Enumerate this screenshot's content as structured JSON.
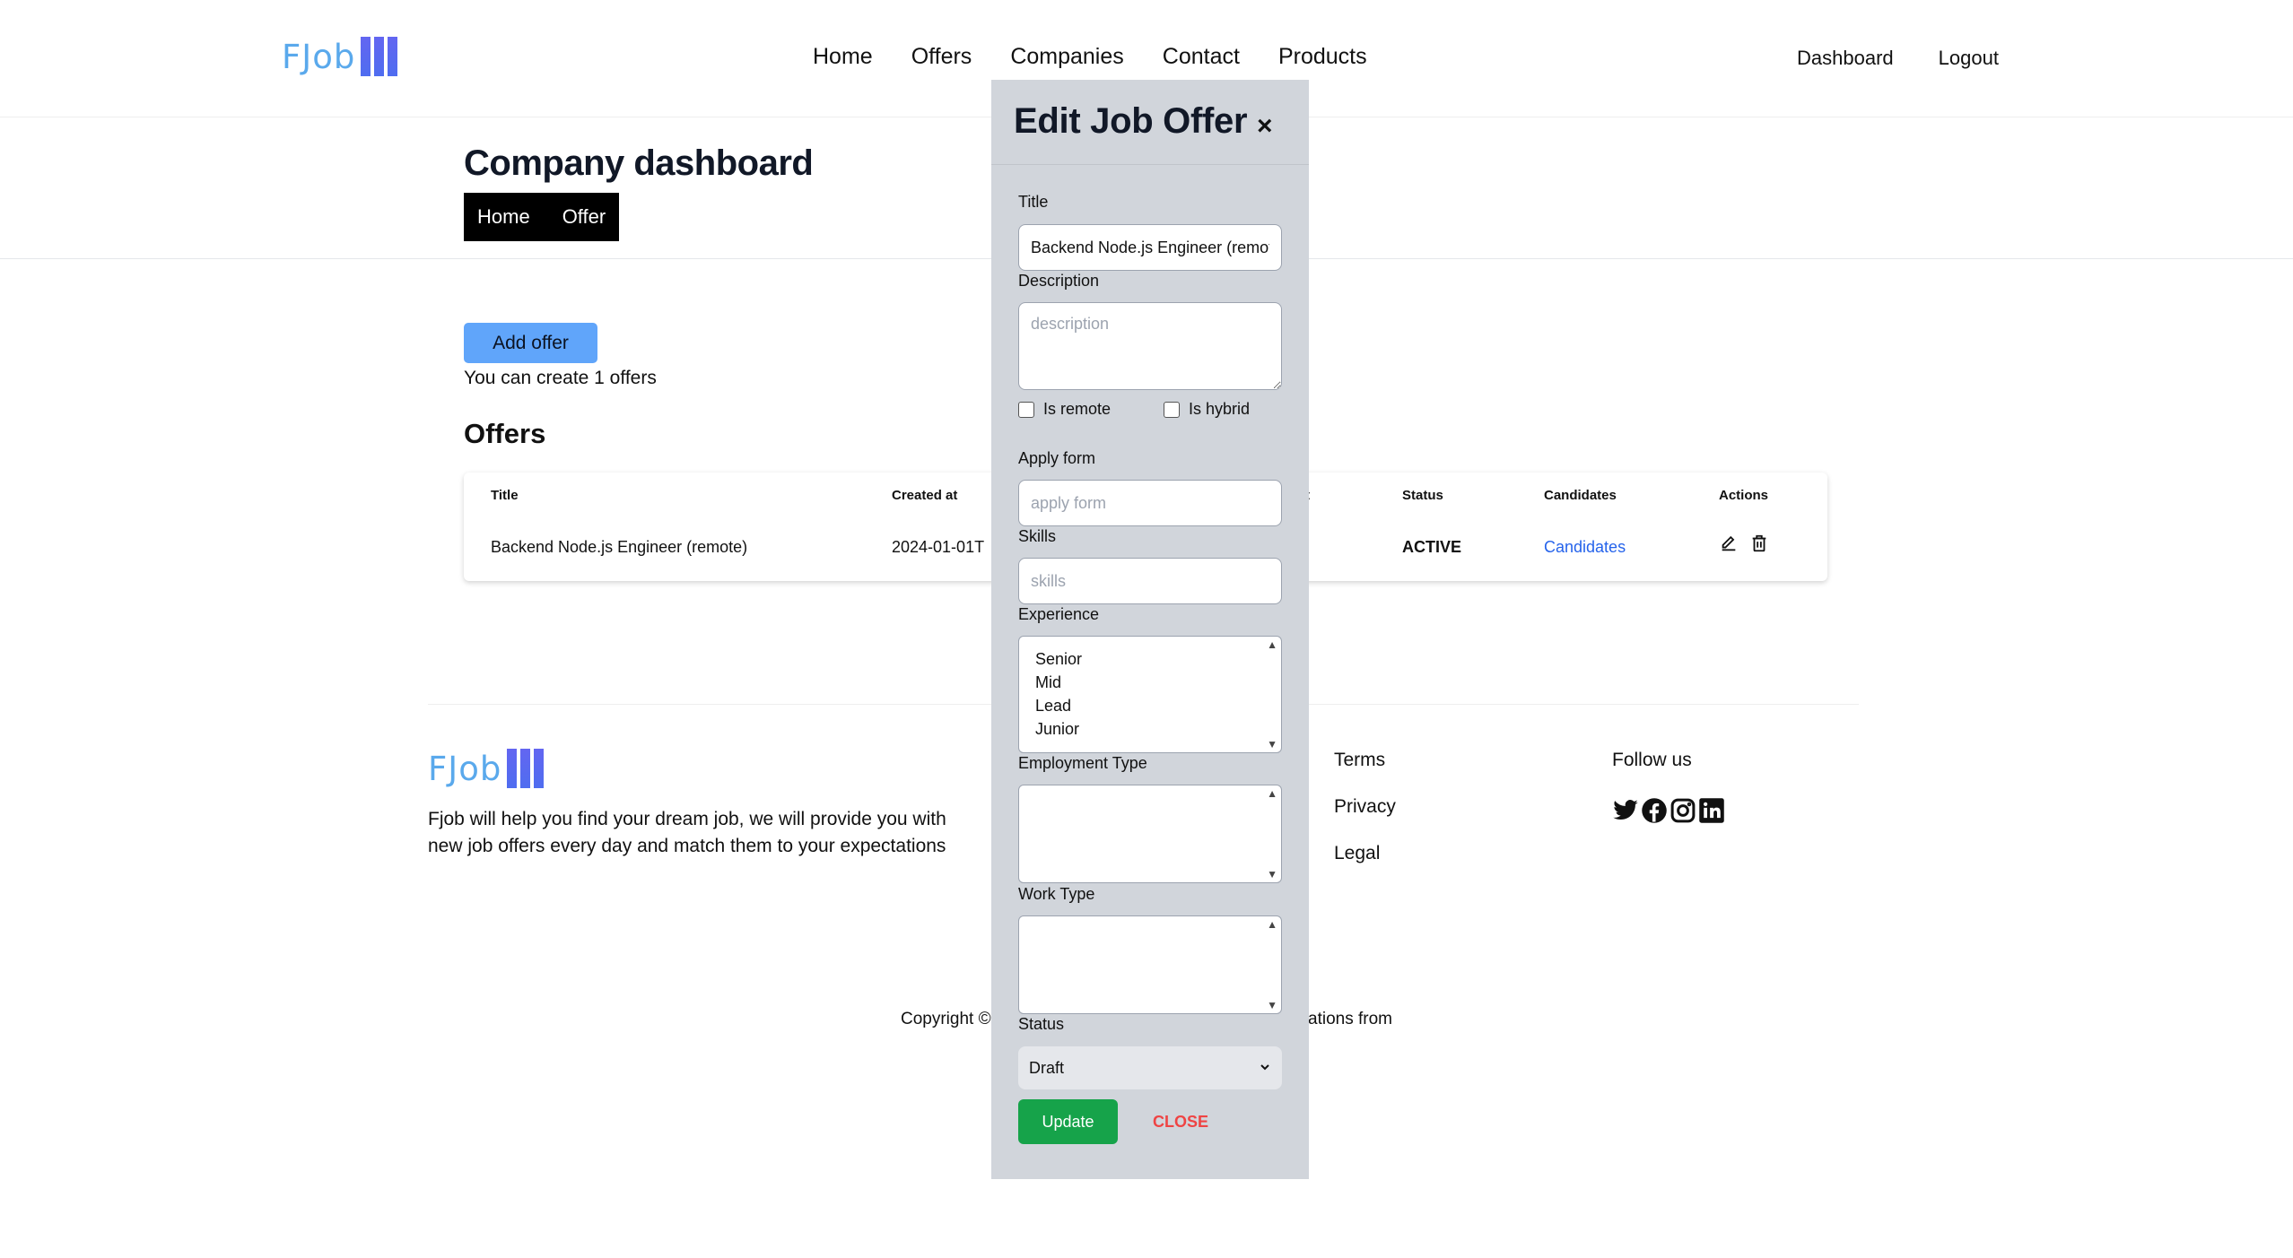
{
  "header": {
    "logo_text": "FJob",
    "nav": [
      "Home",
      "Offers",
      "Companies",
      "Contact",
      "Products"
    ],
    "nav_right": [
      "Dashboard",
      "Logout"
    ]
  },
  "dashboard": {
    "title": "Company dashboard",
    "subnav": [
      "Home",
      "Offer"
    ],
    "add_offer_label": "Add offer",
    "create_note": "You can create 1 offers",
    "offers_title": "Offers"
  },
  "table": {
    "headers": {
      "title": "Title",
      "created_at": "Created at",
      "expired_at_fragment": "t",
      "status": "Status",
      "candidates": "Candidates",
      "actions": "Actions"
    },
    "rows": [
      {
        "title": "Backend Node.js Engineer (remote)",
        "created_at": "2024-01-01T",
        "status": "ACTIVE",
        "candidates": "Candidates"
      }
    ]
  },
  "footer": {
    "logo_text": "FJob",
    "description": "Fjob will help you find your dream job, we will provide you with new job offers every day and match them to your expectations",
    "links": [
      "Terms",
      "Privacy",
      "Legal"
    ],
    "follow_label": "Follow us",
    "social_icons": [
      "twitter-icon",
      "facebook-icon",
      "instagram-icon",
      "linkedin-icon"
    ],
    "copyright_start": "Copyright ©",
    "copyright_end": "ations from"
  },
  "modal": {
    "title": "Edit Job Offer",
    "close_symbol": "×",
    "title_label": "Title",
    "title_value": "Backend Node.js Engineer (remote)",
    "description_label": "Description",
    "description_placeholder": "description",
    "is_remote_label": "Is remote",
    "is_hybrid_label": "Is hybrid",
    "apply_form_label": "Apply form",
    "apply_form_placeholder": "apply form",
    "skills_label": "Skills",
    "skills_placeholder": "skills",
    "experience_label": "Experience",
    "experience_options": [
      "Senior",
      "Mid",
      "Lead",
      "Junior"
    ],
    "employment_type_label": "Employment Type",
    "work_type_label": "Work Type",
    "status_label": "Status",
    "status_value": "Draft",
    "update_label": "Update",
    "close_label": "CLOSE"
  },
  "colors": {
    "accent_blue": "#60a5fa",
    "link_blue": "#2563eb",
    "update_green": "#16a34a",
    "close_red": "#ef4444",
    "modal_bg": "#d1d5db"
  }
}
